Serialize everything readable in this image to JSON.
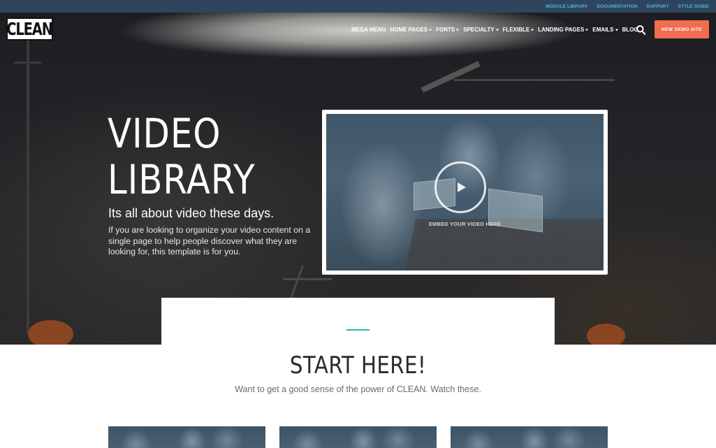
{
  "topbar": {
    "links": [
      "MODULE LIBRARY",
      "DOCUMENTATION",
      "SUPPORT",
      "STYLE GUIDE"
    ]
  },
  "header": {
    "logo": "CLEAN",
    "nav": [
      {
        "label": "MEGA MENU",
        "dropdown": false
      },
      {
        "label": "HOME PAGES",
        "dropdown": true
      },
      {
        "label": "FONTS",
        "dropdown": true
      },
      {
        "label": "SPECIALTY",
        "dropdown": true
      },
      {
        "label": "FLEXIBLE",
        "dropdown": true
      },
      {
        "label": "LANDING PAGES",
        "dropdown": true
      },
      {
        "label": "EMAILS",
        "dropdown": true
      },
      {
        "label": "BLOG",
        "dropdown": false
      }
    ],
    "search_icon": "search-icon",
    "cta": "NEW DEMO SITE",
    "cta_color": "#f26c4f"
  },
  "hero": {
    "title_line1": "VIDEO",
    "title_line2": "LIBRARY",
    "subtitle": "Its all about video these days.",
    "description": "If you are looking to organize your video content on a single page to help people discover what they are looking for, this template is for you.",
    "video_label": "EMBED YOUR VIDEO HERE",
    "play_icon": "play-icon"
  },
  "section": {
    "title": "START HERE!",
    "subtitle": "Want to get a good sense of the power of CLEAN. Watch these.",
    "accent_color": "#2ab5a8"
  }
}
